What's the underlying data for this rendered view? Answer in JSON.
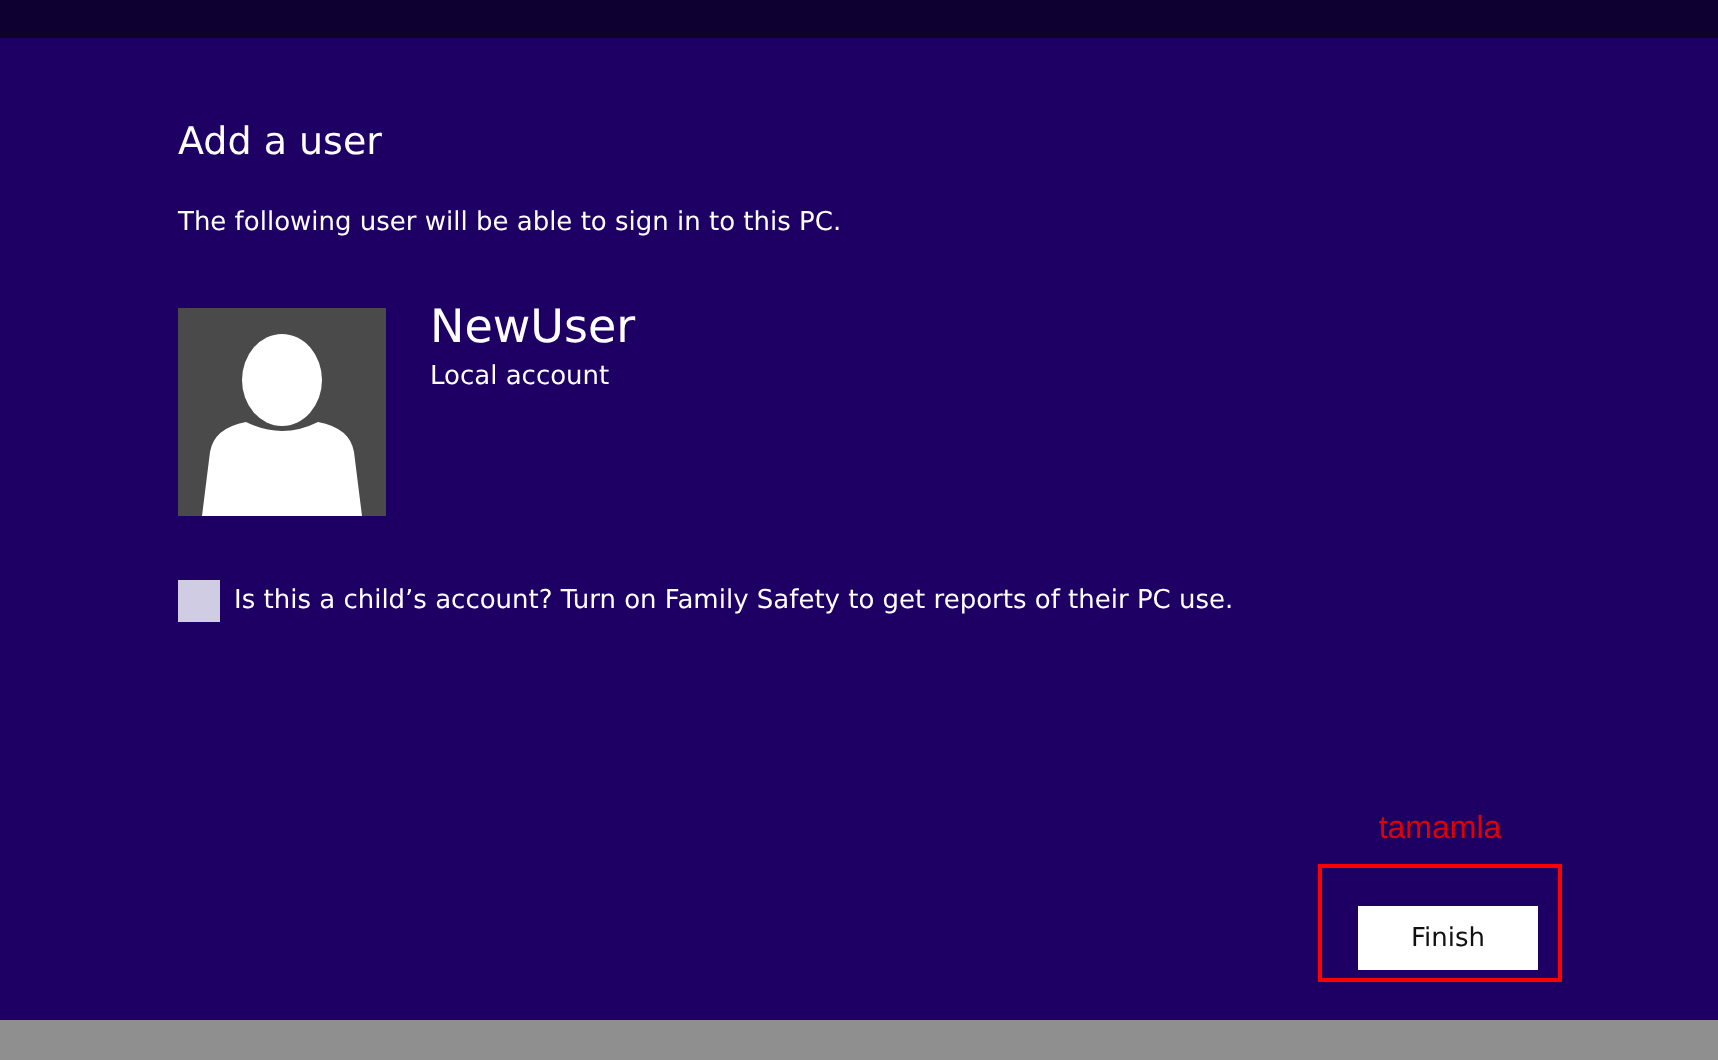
{
  "page": {
    "title": "Add a user",
    "subtitle": "The following user will be able to sign in to this PC."
  },
  "user": {
    "name": "NewUser",
    "account_type": "Local account"
  },
  "child_account": {
    "label": "Is this a child’s account? Turn on Family Safety to get reports of their PC use.",
    "checked": false
  },
  "annotation": {
    "label": "tamamla"
  },
  "buttons": [
    {
      "label": "Finish"
    }
  ]
}
